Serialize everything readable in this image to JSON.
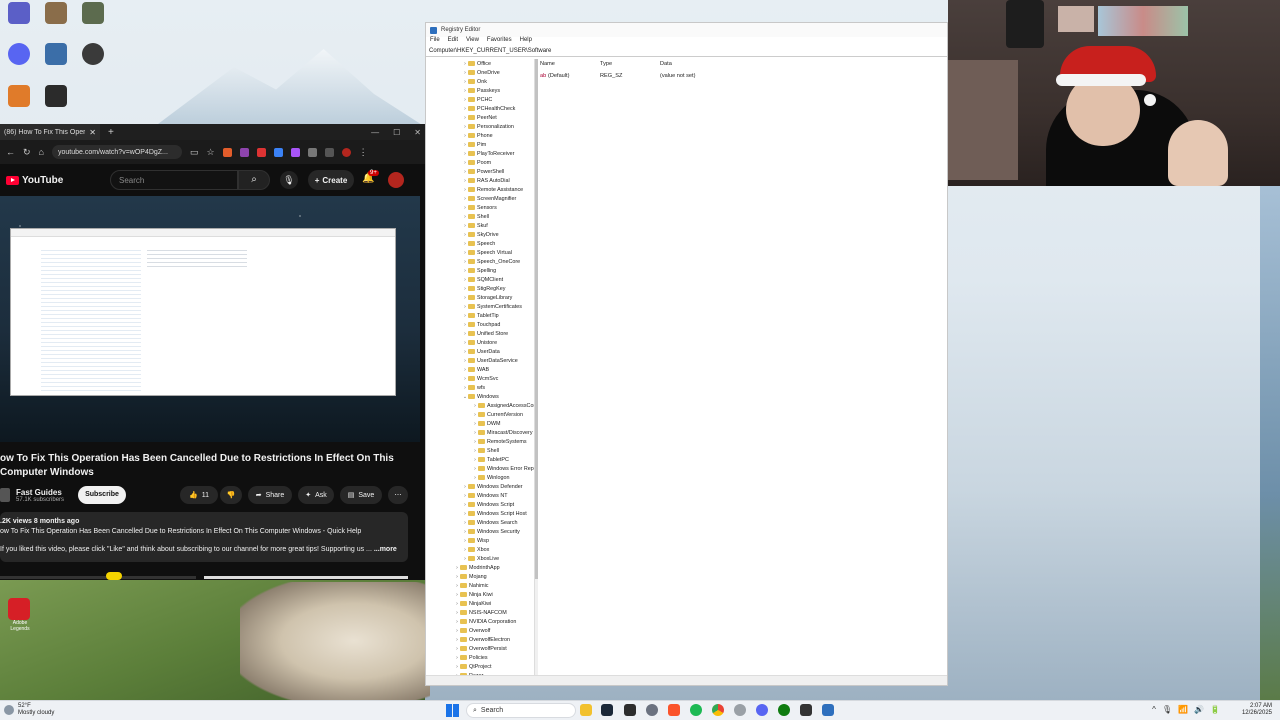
{
  "browser": {
    "tab_title": "(86) How To Fix This Operation",
    "url": "youtube.com/watch?v=wOP4DgZ...",
    "yt_logo_text": "YouTube",
    "search_placeholder": "Search",
    "create_label": "Create",
    "notification_count": "9+",
    "video_title": "ow To Fix This Operation Has Been Cancelled Due to Restrictions In Effect On This Computer Windows",
    "channel_name": "Fast Guides",
    "channel_subs": "57.1K subscribers",
    "subscribe_label": "Subscribe",
    "like_count": "11",
    "share_label": "Share",
    "ask_label": "Ask",
    "save_label": "Save",
    "desc_meta": ".2K views  8 months ago",
    "desc_line1": "ow To Fix This Operation Has Been Cancelled Due to Restrictions In Effect On This Computer Windows - Quick Help",
    "desc_line2": "If you liked this video, please click \"Like\" and think about subscribing to our channel for more great tips! Supporting us ...",
    "more_label": "...more"
  },
  "regedit": {
    "title": "Registry Editor",
    "menu": [
      "File",
      "Edit",
      "View",
      "Favorites",
      "Help"
    ],
    "address": "Computer\\HKEY_CURRENT_USER\\Software",
    "columns": {
      "name": "Name",
      "type": "Type",
      "data": "Data"
    },
    "row": {
      "name": "(Default)",
      "type": "REG_SZ",
      "data": "(value not set)"
    },
    "tree": [
      {
        "label": "Office",
        "level": 2
      },
      {
        "label": "OneDrive",
        "level": 2
      },
      {
        "label": "Onk",
        "level": 2
      },
      {
        "label": "Passkeys",
        "level": 2
      },
      {
        "label": "PCHC",
        "level": 2
      },
      {
        "label": "PCHealthCheck",
        "level": 2
      },
      {
        "label": "PeerNet",
        "level": 2
      },
      {
        "label": "Personalization",
        "level": 2
      },
      {
        "label": "Phone",
        "level": 2
      },
      {
        "label": "Pim",
        "level": 2
      },
      {
        "label": "PlayToReceiver",
        "level": 2
      },
      {
        "label": "Poom",
        "level": 2
      },
      {
        "label": "PowerShell",
        "level": 2
      },
      {
        "label": "RAS AutoDial",
        "level": 2
      },
      {
        "label": "Remote Assistance",
        "level": 2
      },
      {
        "label": "ScreenMagnifier",
        "level": 2
      },
      {
        "label": "Sensors",
        "level": 2
      },
      {
        "label": "Shell",
        "level": 2
      },
      {
        "label": "Skuf",
        "level": 2
      },
      {
        "label": "SkyDrive",
        "level": 2
      },
      {
        "label": "Speech",
        "level": 2
      },
      {
        "label": "Speech Virtual",
        "level": 2
      },
      {
        "label": "Speech_OneCore",
        "level": 2
      },
      {
        "label": "Spelling",
        "level": 2
      },
      {
        "label": "SQMClient",
        "level": 2
      },
      {
        "label": "StigRegKey",
        "level": 2
      },
      {
        "label": "StorageLibrary",
        "level": 2
      },
      {
        "label": "SystemCertificates",
        "level": 2
      },
      {
        "label": "TabletTip",
        "level": 2
      },
      {
        "label": "Touchpad",
        "level": 2
      },
      {
        "label": "Unified Store",
        "level": 2
      },
      {
        "label": "Unistore",
        "level": 2
      },
      {
        "label": "UserData",
        "level": 2
      },
      {
        "label": "UserDataService",
        "level": 2
      },
      {
        "label": "WAB",
        "level": 2
      },
      {
        "label": "WcmSvc",
        "level": 2
      },
      {
        "label": "wfs",
        "level": 2
      },
      {
        "label": "Windows",
        "level": 2,
        "expanded": true
      },
      {
        "label": "AssignedAccessConfiguration",
        "level": 3
      },
      {
        "label": "CurrentVersion",
        "level": 3
      },
      {
        "label": "DWM",
        "level": 3
      },
      {
        "label": "Miracast/Discovery",
        "level": 3
      },
      {
        "label": "RemoteSystems",
        "level": 3
      },
      {
        "label": "Shell",
        "level": 3
      },
      {
        "label": "TabletPC",
        "level": 3
      },
      {
        "label": "Windows Error Reporting",
        "level": 3
      },
      {
        "label": "Winlogon",
        "level": 3
      },
      {
        "label": "Windows Defender",
        "level": 2
      },
      {
        "label": "Windows NT",
        "level": 2
      },
      {
        "label": "Windows Script",
        "level": 2
      },
      {
        "label": "Windows Script Host",
        "level": 2
      },
      {
        "label": "Windows Search",
        "level": 2
      },
      {
        "label": "Windows Security",
        "level": 2
      },
      {
        "label": "Wisp",
        "level": 2
      },
      {
        "label": "Xbox",
        "level": 2
      },
      {
        "label": "XboxLive",
        "level": 2
      },
      {
        "label": "ModrinthApp",
        "level": 1
      },
      {
        "label": "Mojang",
        "level": 1
      },
      {
        "label": "Nahimic",
        "level": 1
      },
      {
        "label": "Ninja Kiwi",
        "level": 1
      },
      {
        "label": "NinjaKiwi",
        "level": 1
      },
      {
        "label": "NSIS-NAFCOM",
        "level": 1
      },
      {
        "label": "NVIDIA Corporation",
        "level": 1
      },
      {
        "label": "Overwolf",
        "level": 1
      },
      {
        "label": "OverwolfElectron",
        "level": 1
      },
      {
        "label": "OverwolfPersist",
        "level": 1
      },
      {
        "label": "Policies",
        "level": 1
      },
      {
        "label": "QtProject",
        "level": 1
      },
      {
        "label": "Razer",
        "level": 1
      }
    ]
  },
  "desktop": {
    "shortcut_label": "Adobe Legends"
  },
  "taskbar": {
    "weather_temp": "52°F",
    "weather_desc": "Mostly cloudy",
    "search_label": "Search",
    "time": "2:07 AM",
    "date": "12/26/2025"
  }
}
